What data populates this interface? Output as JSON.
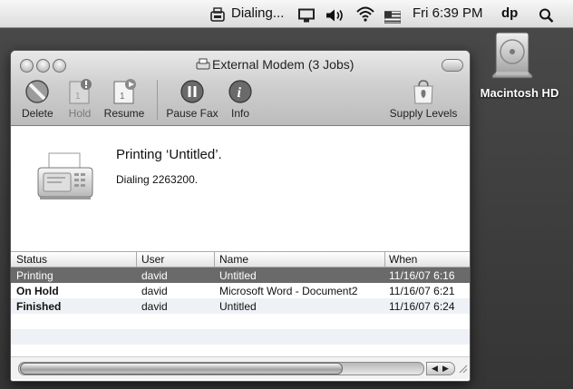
{
  "menubar": {
    "status_text": "Dialing...",
    "clock": "Fri 6:39 PM",
    "user": "dp",
    "icons": [
      "fax-status-icon",
      "display-icon",
      "volume-icon",
      "wifi-icon",
      "flag-icon",
      "spotlight-icon"
    ]
  },
  "desktop": {
    "hd_label": "Macintosh HD"
  },
  "window": {
    "title": "External Modem (3 Jobs)",
    "toolbar": {
      "delete": "Delete",
      "hold": "Hold",
      "resume": "Resume",
      "pause_fax": "Pause Fax",
      "info": "Info",
      "supply_levels": "Supply Levels"
    },
    "status": {
      "title": "Printing ‘Untitled’.",
      "subtitle": "Dialing 2263200."
    },
    "table": {
      "headers": {
        "status": "Status",
        "user": "User",
        "name": "Name",
        "when": "When"
      },
      "rows": [
        {
          "status": "Printing",
          "user": "david",
          "name": "Untitled",
          "when": "11/16/07 6:16"
        },
        {
          "status": "On Hold",
          "user": "david",
          "name": "Microsoft Word - Document2",
          "when": "11/16/07 6:21"
        },
        {
          "status": "Finished",
          "user": "david",
          "name": "Untitled",
          "when": "11/16/07 6:24"
        }
      ]
    }
  }
}
